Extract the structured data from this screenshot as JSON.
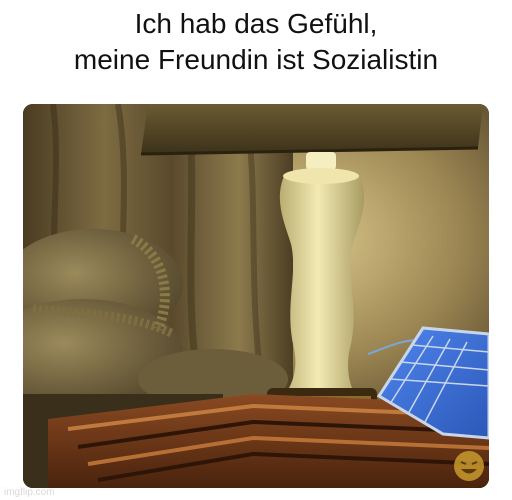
{
  "meme": {
    "caption_line1": "Ich hab das Gefühl,",
    "caption_line2": "meine Freundin ist Sozialistin"
  },
  "watermark": "imgflip.com",
  "colors": {
    "background": "#ffffff",
    "caption_text": "#111111",
    "lamp_glow": "#f3eab4",
    "solar_panel": "#3b6fd8"
  },
  "icons": {
    "corner_emoji": "laughing-face-icon"
  }
}
